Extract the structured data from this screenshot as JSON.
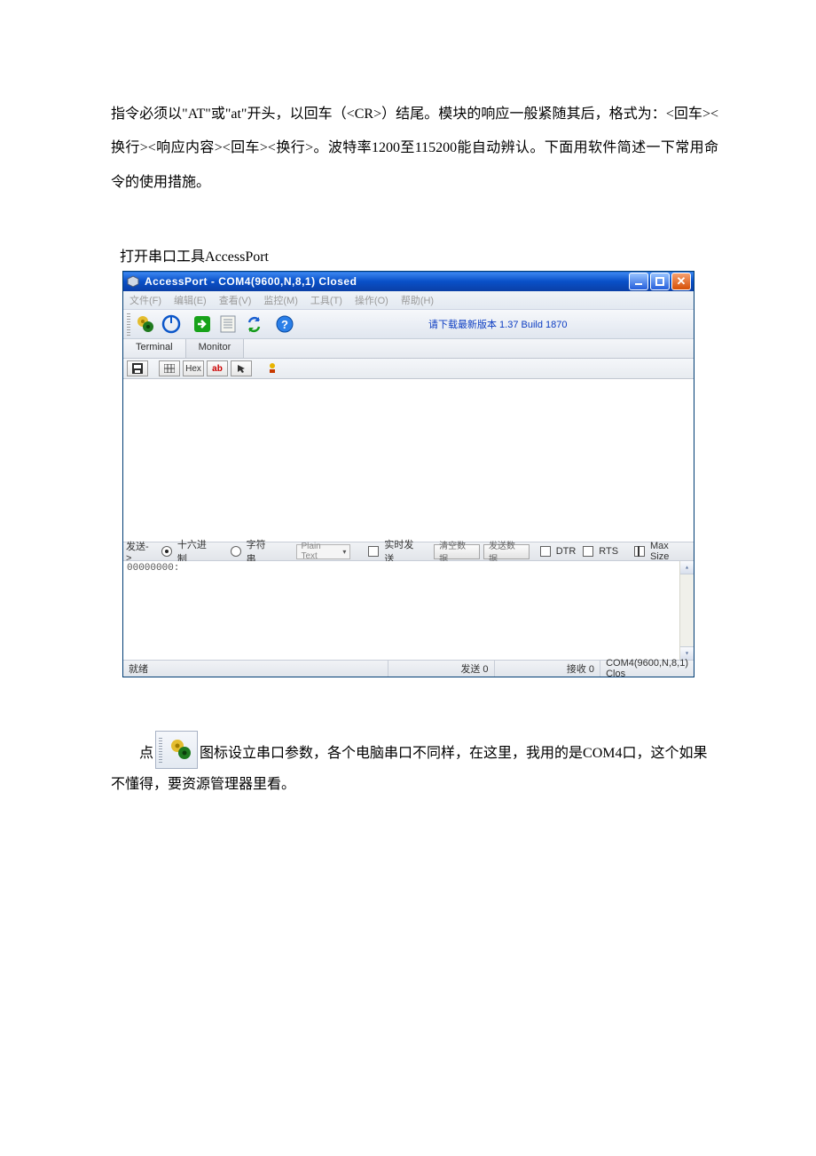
{
  "doc": {
    "para1": "指令必须以\"AT\"或\"at\"开头，以回车（<CR>）结尾。模块的响应一般紧随其后，格式为：<回车><换行><响应内容><回车><换行>。波特率1200至115200能自动辨认。下面用软件简述一下常用命令的使用措施。",
    "para2": "打开串口工具AccessPort",
    "bottom_pre": "点",
    "bottom_post": "图标设立串口参数，各个电脑串口不同样，在这里，我用的是COM4口，这个如果不懂得，要资源管理器里看。"
  },
  "app": {
    "title": "AccessPort - COM4(9600,N,8,1) Closed",
    "menus": [
      "文件(F)",
      "编辑(E)",
      "查看(V)",
      "监控(M)",
      "工具(T)",
      "操作(O)",
      "帮助(H)"
    ],
    "update_link": "请下载最新版本 1.37 Build 1870",
    "tabs": {
      "terminal": "Terminal",
      "monitor": "Monitor"
    },
    "subtool": {
      "hex": "Hex",
      "ab": "ab"
    },
    "send": {
      "label": "发送->",
      "radio_hex": "十六进制",
      "radio_str": "字符串",
      "plain_text": "Plain Text",
      "realtime": "实时发送",
      "clear": "清空数据",
      "send_btn": "发送数据",
      "dtr": "DTR",
      "rts": "RTS",
      "max_size": "Max Size"
    },
    "lower_text": "00000000:",
    "status": {
      "ready": "就绪",
      "tx": "发送 0",
      "rx": "接收 0",
      "port": "COM4(9600,N,8,1) Clos"
    }
  }
}
